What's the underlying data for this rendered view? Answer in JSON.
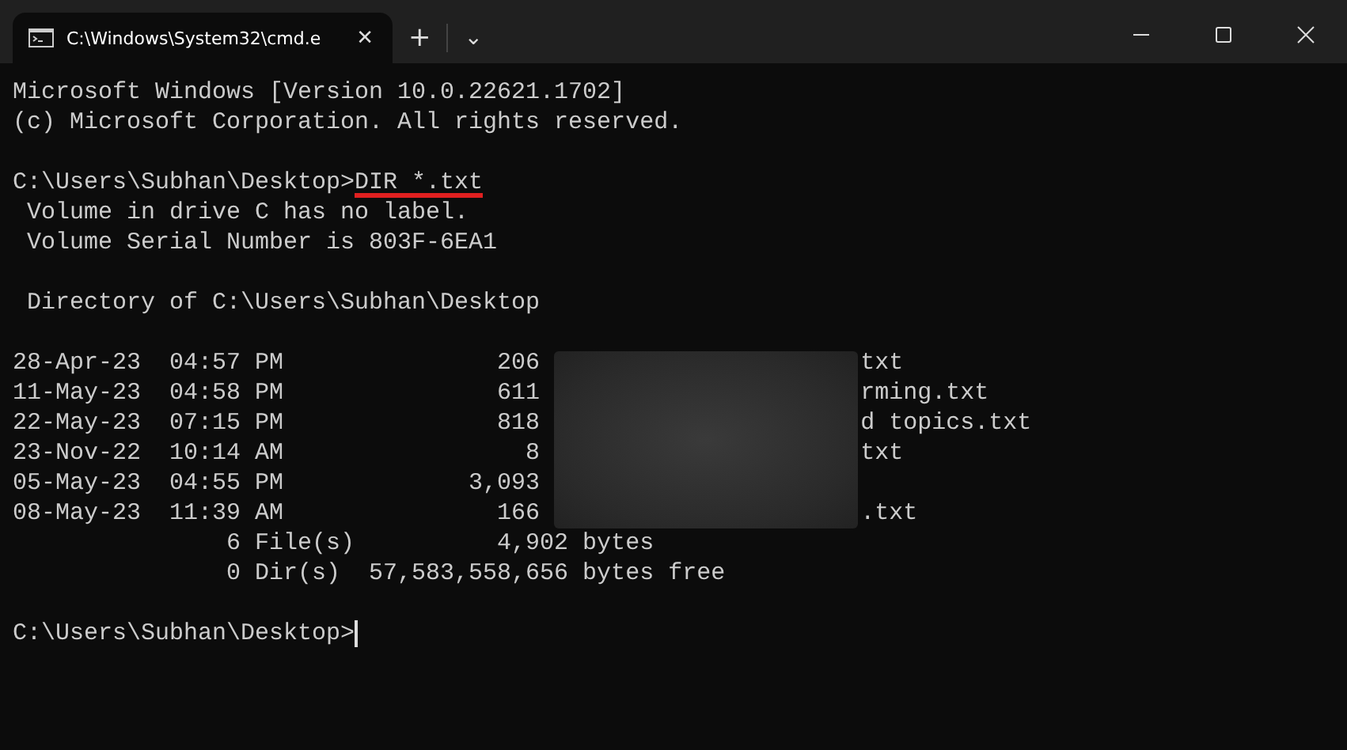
{
  "window": {
    "tab_title": "C:\\Windows\\System32\\cmd.e",
    "tab_close": "✕",
    "new_tab": "+",
    "dropdown": "⌄"
  },
  "console": {
    "banner": [
      "Microsoft Windows [Version 10.0.22621.1702]",
      "(c) Microsoft Corporation. All rights reserved."
    ],
    "prompt": "C:\\Users\\Subhan\\Desktop>",
    "command": "DIR *.txt",
    "volume_info": [
      " Volume in drive C has no label.",
      " Volume Serial Number is 803F-6EA1"
    ],
    "directory_line": " Directory of C:\\Users\\Subhan\\Desktop",
    "rows": [
      {
        "prefix": "28-Apr-23  04:57 PM               206 ",
        "suffix": "txt"
      },
      {
        "prefix": "11-May-23  04:58 PM               611 ",
        "suffix": "rming.txt"
      },
      {
        "prefix": "22-May-23  07:15 PM               818 ",
        "suffix": "d topics.txt"
      },
      {
        "prefix": "23-Nov-22  10:14 AM                 8 ",
        "suffix": "txt"
      },
      {
        "prefix": "05-May-23  04:55 PM             3,093 "
      },
      {
        "prefix": "08-May-23  11:39 AM               166 ",
        "suffix": ".txt"
      }
    ],
    "summary": [
      "               6 File(s)          4,902 bytes",
      "               0 Dir(s)  57,583,558,656 bytes free"
    ],
    "final_prompt": "C:\\Users\\Subhan\\Desktop>"
  }
}
